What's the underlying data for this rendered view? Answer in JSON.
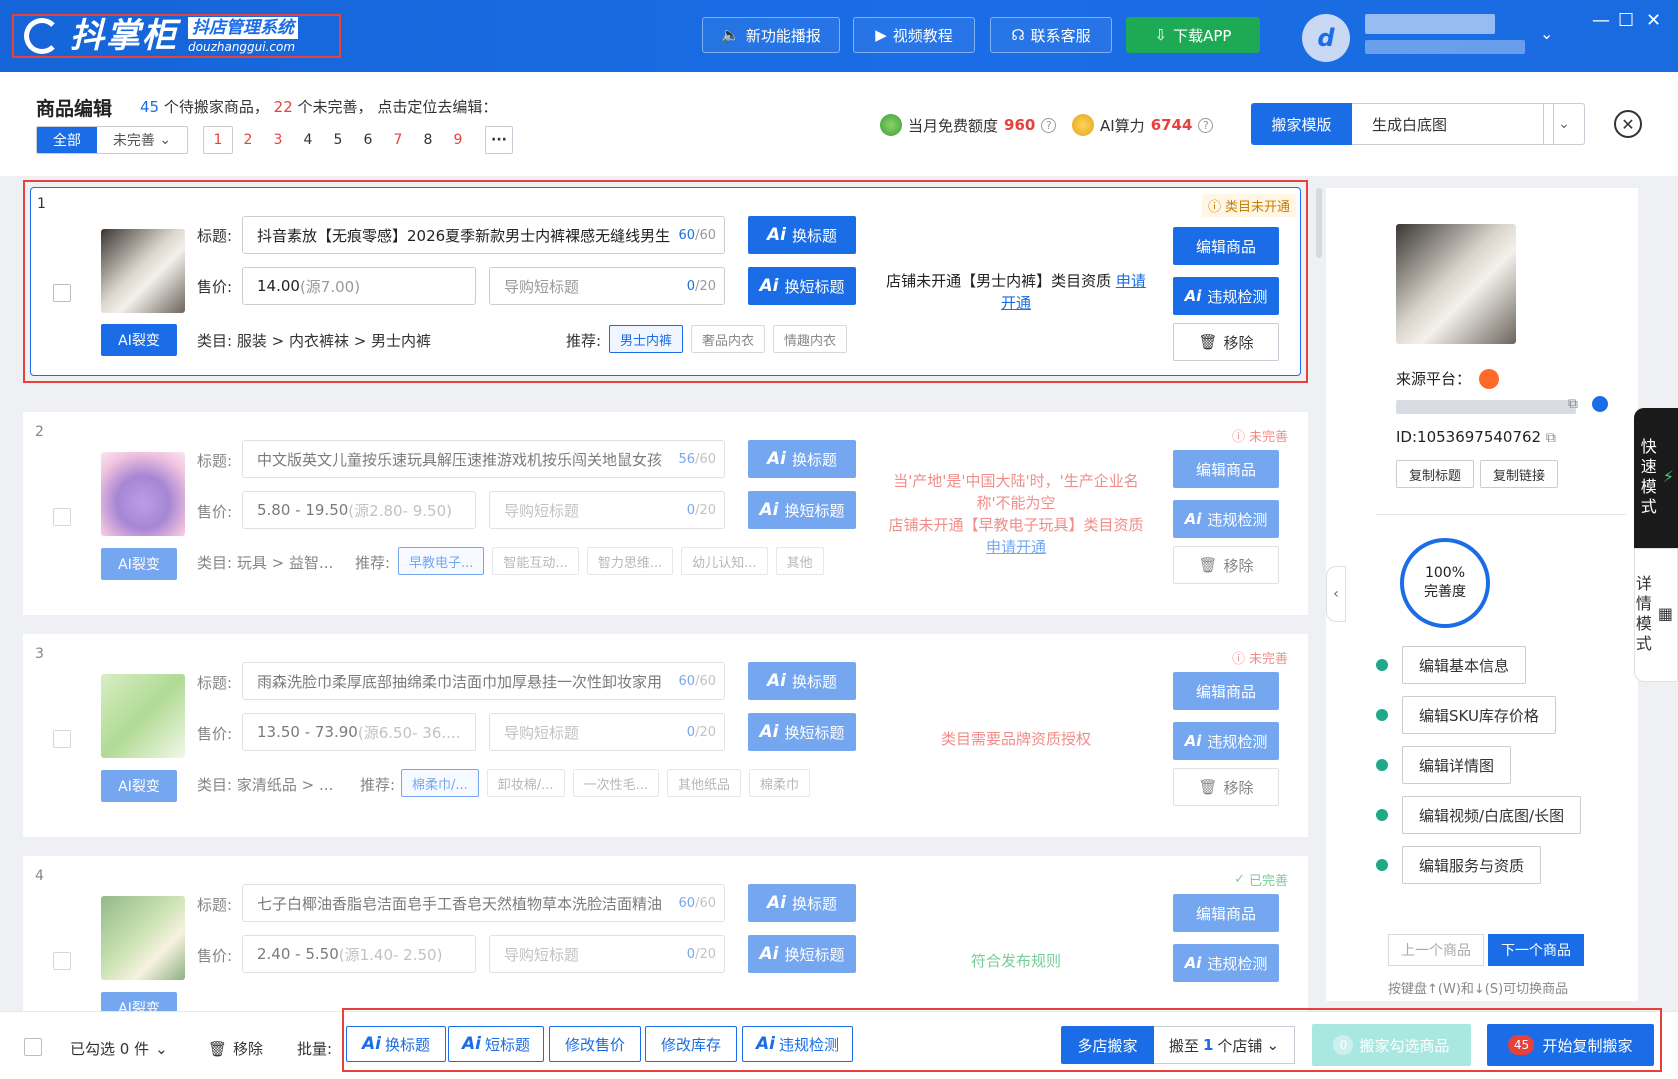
{
  "app": {
    "logo_name": "抖掌柜",
    "logo_sub_cn": "抖店管理系统",
    "logo_sub_en": "douzhanggui.com"
  },
  "topbar": {
    "buttons": [
      "新功能播报",
      "视频教程",
      "联系客服",
      "下载APP"
    ],
    "window_controls": [
      "—",
      "☐",
      "✕"
    ]
  },
  "header": {
    "title": "商品编辑",
    "summary_pending_count": "45",
    "summary_pending_text": "个待搬家商品，",
    "summary_incomplete_count": "22",
    "summary_incomplete_text": "个未完善， 点击定位去编辑：",
    "filter_all": "全部",
    "filter_incomplete": "未完善",
    "pages": [
      "1",
      "2",
      "3",
      "4",
      "5",
      "6",
      "7",
      "8",
      "9"
    ],
    "pages_red": [
      true,
      true,
      true,
      false,
      false,
      false,
      true,
      false,
      true
    ],
    "more": "···",
    "free_quota_label": "当月免费额度",
    "free_quota_value": "960",
    "ai_power_label": "AI算力",
    "ai_power_value": "6744",
    "template_button": "搬家模版",
    "template_selected": "生成白底图"
  },
  "items": [
    {
      "index": "1",
      "status": "类目未开通",
      "title_label": "标题:",
      "title": "抖音素放【无痕零感】2026夏季新款男士内裤裸感无缝线男生",
      "title_count": "60",
      "title_max": "/60",
      "price_label": "售价:",
      "price": "14.00",
      "price_src": "(源7.00)",
      "short_placeholder": "导购短标题",
      "short_count": "0",
      "short_max": "/20",
      "category_label": "类目:",
      "category": "服装 > 内衣裤袜 > 男士内裤",
      "recommend_label": "推荐:",
      "tags": [
        "男士内裤",
        "奢品内衣",
        "情趣内衣"
      ],
      "message_lines": [
        "店铺未开通【男士内裤】类目资质 "
      ],
      "message_link": "申请开通",
      "msg_color": "black"
    },
    {
      "index": "2",
      "status": "未完善",
      "title_label": "标题:",
      "title": "中文版英文儿童按乐速玩具解压速推游戏机按乐闯关地鼠女孩",
      "title_count": "56",
      "title_max": "/60",
      "price_label": "售价:",
      "price": "5.80 - 19.50",
      "price_src": "(源2.80- 9.50)",
      "short_placeholder": "导购短标题",
      "short_count": "0",
      "short_max": "/20",
      "category_label": "类目:",
      "category": "玩具 > 益智...",
      "recommend_label": "推荐:",
      "tags": [
        "早教电子...",
        "智能互动...",
        "智力思维...",
        "幼儿认知...",
        "其他"
      ],
      "message_lines": [
        "当'产地'是'中国大陆'时，'生产企业名称'不能为空",
        "店铺未开通【早教电子玩具】类目资质 "
      ],
      "message_link": "申请开通",
      "msg_color": "red"
    },
    {
      "index": "3",
      "status": "未完善",
      "title_label": "标题:",
      "title": "雨森洗脸巾柔厚底部抽绵柔巾洁面巾加厚悬挂一次性卸妆家用",
      "title_count": "60",
      "title_max": "/60",
      "price_label": "售价:",
      "price": "13.50 - 73.90",
      "price_src": "(源6.50- 36....",
      "short_placeholder": "导购短标题",
      "short_count": "0",
      "short_max": "/20",
      "category_label": "类目:",
      "category": "家清纸品 > ...",
      "recommend_label": "推荐:",
      "tags": [
        "棉柔巾/...",
        "卸妆棉/...",
        "一次性毛...",
        "其他纸品",
        "棉柔巾"
      ],
      "message_lines": [
        "类目需要品牌资质授权"
      ],
      "message_link": "",
      "msg_color": "red"
    },
    {
      "index": "4",
      "status": "已完善",
      "title_label": "标题:",
      "title": "七子白椰油香脂皂洁面皂手工香皂天然植物草本洗脸洁面精油",
      "title_count": "60",
      "title_max": "/60",
      "price_label": "售价:",
      "price": "2.40 - 5.50",
      "price_src": "(源1.40- 2.50)",
      "short_placeholder": "导购短标题",
      "short_count": "0",
      "short_max": "/20",
      "category_label": "",
      "category": "",
      "recommend_label": "",
      "tags": [],
      "message_lines": [
        "符合发布规则"
      ],
      "message_link": "",
      "msg_color": "green"
    }
  ],
  "item_actions": {
    "ai_split": "AI裂变",
    "change_title": "换标题",
    "change_short_title": "换短标题",
    "edit_product": "编辑商品",
    "violation_check": "违规检测",
    "remove": "移除"
  },
  "right_panel": {
    "source_label": "来源平台：",
    "id_text": "ID:1053697540762",
    "copy_title": "复制标题",
    "copy_link": "复制链接",
    "completeness_value": "100%",
    "completeness_label": "完善度",
    "steps": [
      "编辑基本信息",
      "编辑SKU库存价格",
      "编辑详情图",
      "编辑视频/白底图/长图",
      "编辑服务与资质"
    ],
    "prev": "上一个商品",
    "next": "下一个商品",
    "hint": "按键盘↑(W)和↓(S)可切换商品"
  },
  "mode_tabs": [
    "快速模式",
    "详情模式"
  ],
  "bottom": {
    "selected": "已勾选 0 件",
    "remove": "移除",
    "batch": "批量:",
    "ai_change_title": "换标题",
    "ai_short_title": "短标题",
    "edit_price": "修改售价",
    "edit_stock": "修改库存",
    "ai_violation": "违规检测",
    "multi_store": "多店搬家",
    "move_to_prefix": "搬至",
    "move_to_count": "1",
    "move_to_suffix": "个店铺",
    "move_selected_count": "0",
    "move_selected": "搬家勾选商品",
    "start_count": "45",
    "start": "开始复制搬家"
  },
  "colors": {
    "primary": "#1a6de6",
    "danger": "#e8403a",
    "success": "#1eaa55",
    "warning_bg": "#fff6e5"
  }
}
